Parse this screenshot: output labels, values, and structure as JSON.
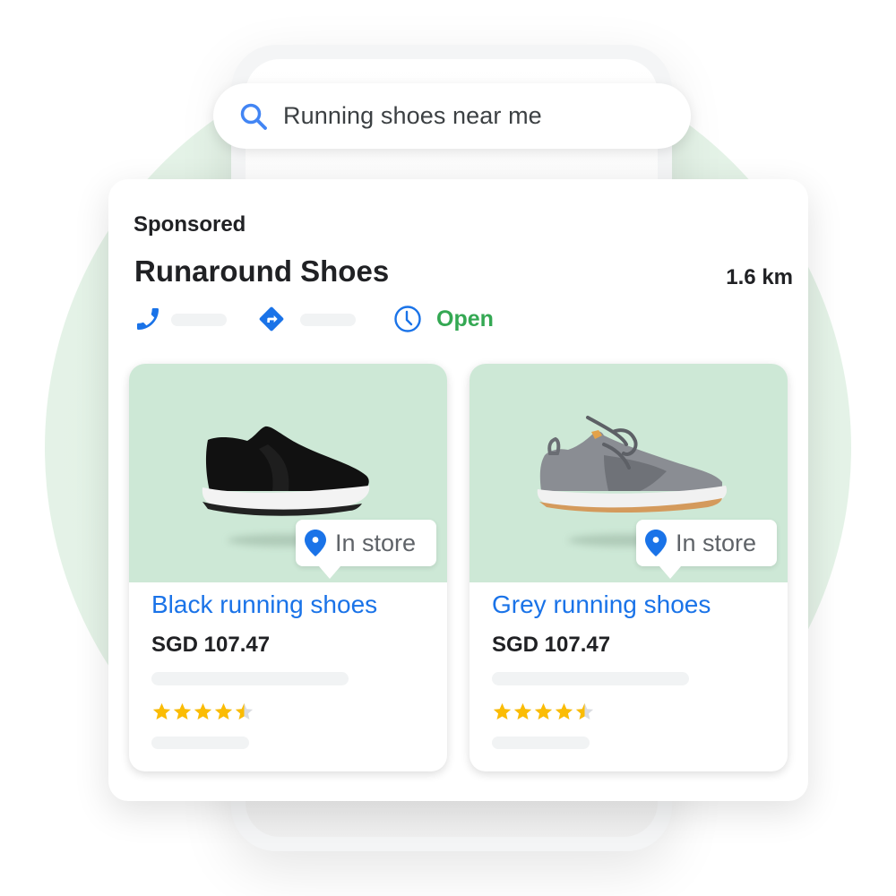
{
  "colors": {
    "accent_blue": "#1a73e8",
    "open_green": "#34a853",
    "star_gold": "#fbbc04",
    "star_empty": "#dadce0",
    "image_bg": "#cde8d6"
  },
  "search": {
    "icon": "search-icon",
    "query": "Running shoes near me"
  },
  "listing": {
    "label": "Sponsored",
    "store_name": "Runaround Shoes",
    "distance": "1.6 km",
    "actions": {
      "phone_icon": "phone-icon",
      "directions_icon": "directions-icon",
      "hours_icon": "clock-icon",
      "status": "Open"
    }
  },
  "products": [
    {
      "title": "Black running shoes",
      "price": "SGD 107.47",
      "badge": "In store",
      "badge_icon": "location-pin-icon",
      "rating": 4.5,
      "rating_max": 5,
      "image": "black-shoe-image"
    },
    {
      "title": "Grey running shoes",
      "price": "SGD 107.47",
      "badge": "In store",
      "badge_icon": "location-pin-icon",
      "rating": 4.5,
      "rating_max": 5,
      "image": "grey-shoe-image"
    }
  ]
}
